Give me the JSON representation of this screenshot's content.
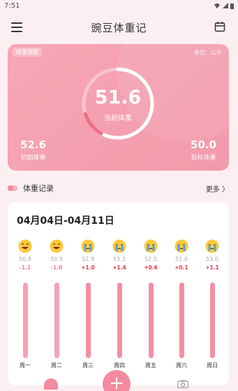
{
  "status": {
    "time": "7:51"
  },
  "header": {
    "title": "豌豆体重记"
  },
  "summary": {
    "tag": "体重变跟",
    "unit": "单位：公斤",
    "current_value": "51.6",
    "current_label": "当前体重",
    "progress_fraction": 0.7,
    "start_value": "52.6",
    "start_label": "初始体重",
    "target_value": "50.0",
    "target_label": "目标体重"
  },
  "records": {
    "title": "体重记录",
    "more": "更多 〉"
  },
  "week": {
    "range": "04月04日-04月11日",
    "days": [
      {
        "name": "周一",
        "weight": "50.8",
        "delta": "-1.1",
        "trend": "down",
        "mood": "laugh"
      },
      {
        "name": "周二",
        "weight": "50.9",
        "delta": "-1.0",
        "trend": "down",
        "mood": "laugh"
      },
      {
        "name": "周三",
        "weight": "52.9",
        "delta": "+1.0",
        "trend": "up",
        "mood": "cry"
      },
      {
        "name": "周四",
        "weight": "53.3",
        "delta": "+1.4",
        "trend": "up",
        "mood": "cry"
      },
      {
        "name": "周五",
        "weight": "52.5",
        "delta": "+0.6",
        "trend": "up",
        "mood": "cry"
      },
      {
        "name": "周六",
        "weight": "52.0",
        "delta": "+0.1",
        "trend": "up",
        "mood": "cry"
      },
      {
        "name": "周日",
        "weight": "53.0",
        "delta": "+1.1",
        "trend": "up",
        "mood": "cry"
      }
    ]
  },
  "colors": {
    "accent": "#f48a9e",
    "card": "#f5a3b3",
    "up": "#e53950"
  },
  "nav": {
    "add_label": "+"
  }
}
